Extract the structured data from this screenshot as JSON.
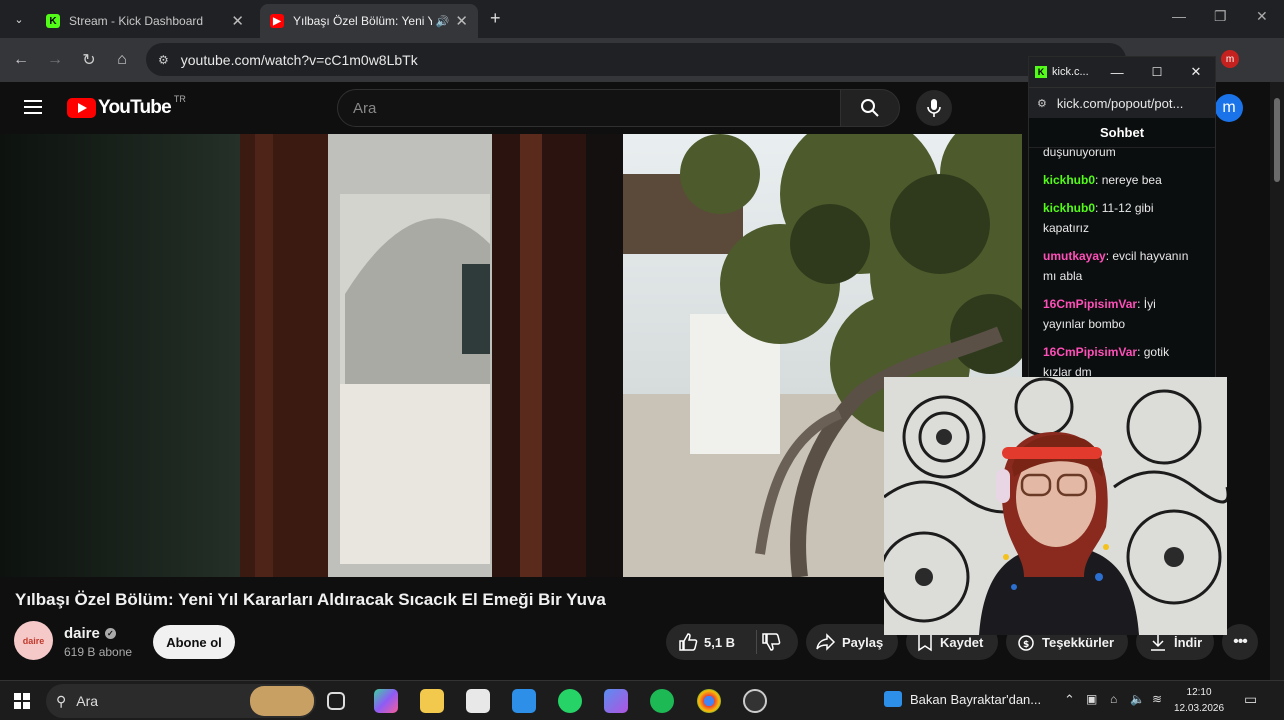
{
  "browser": {
    "tabs": [
      {
        "title": "Stream - Kick Dashboard",
        "active": false
      },
      {
        "title": "Yılbaşı Özel Bölüm: Yeni Yıl",
        "active": true
      }
    ],
    "url": "youtube.com/watch?v=cC1m0w8LbTk",
    "profile_initial": "m"
  },
  "youtube": {
    "logo_text": "YouTube",
    "country_code": "TR",
    "search_placeholder": "Ara",
    "avatar_initial": "m",
    "video_title": "Yılbaşı Özel Bölüm: Yeni Yıl Kararları Aldıracak Sıcacık El Emeği Bir Yuva",
    "channel": {
      "name": "daire",
      "subscribers": "619 B abone",
      "avatar_text": "daire"
    },
    "subscribe_label": "Abone ol",
    "likes": "5,1 B",
    "share_label": "Paylaş",
    "save_label": "Kaydet",
    "thanks_label": "Teşekkürler",
    "download_label": "İndir",
    "more_label": "•••"
  },
  "kick_popout": {
    "window_title": "kick.c...",
    "url": "kick.com/popout/pot...",
    "chat_title": "Sohbet",
    "messages": [
      {
        "user": "",
        "text": "duşunuyorum",
        "color": "#e8e8e8"
      },
      {
        "user": "kickhub0",
        "text": "nereye bea",
        "color": "#53fc18"
      },
      {
        "user": "kickhub0",
        "text": "11-12 gibi kapatırız",
        "color": "#53fc18"
      },
      {
        "user": "umutkayay",
        "text": "evcil hayvanın mı abla",
        "color": "#ff4fb8"
      },
      {
        "user": "16CmPipisimVar",
        "text": "İyi yayınlar bombo",
        "color": "#ff4fb8"
      },
      {
        "user": "16CmPipisimVar",
        "text": "gotik kızlar dm",
        "color": "#ff4fb8"
      }
    ]
  },
  "taskbar": {
    "search_label": "Ara",
    "news_text": "Bakan Bayraktar'dan...",
    "time": "12:10",
    "date": "12.03.2026"
  },
  "colors": {
    "accent": "#ff0000",
    "kick_green": "#53fc18"
  }
}
